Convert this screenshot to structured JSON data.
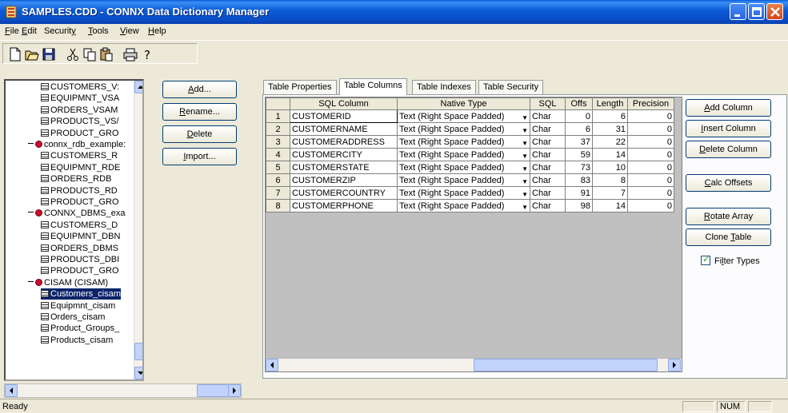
{
  "window": {
    "title": "SAMPLES.CDD - CONNX Data Dictionary Manager"
  },
  "menu": [
    {
      "label_pre": "",
      "label_key": "F",
      "label_post": "ile"
    },
    {
      "label_pre": "",
      "label_key": "E",
      "label_post": "dit"
    },
    {
      "label_pre": "Securit",
      "label_key": "y",
      "label_post": ""
    },
    {
      "label_pre": "",
      "label_key": "T",
      "label_post": "ools"
    },
    {
      "label_pre": "",
      "label_key": "V",
      "label_post": "iew"
    },
    {
      "label_pre": "",
      "label_key": "H",
      "label_post": "elp"
    }
  ],
  "toolbar": {
    "icons": [
      "new-icon",
      "open-icon",
      "save-icon",
      "cut-icon",
      "copy-icon",
      "paste-icon",
      "print-icon",
      "help-icon"
    ]
  },
  "tree": {
    "items": [
      {
        "type": "table",
        "label": "CUSTOMERS_V:",
        "indent": 1
      },
      {
        "type": "table",
        "label": "EQUIPMNT_VSA",
        "indent": 1
      },
      {
        "type": "table",
        "label": "ORDERS_VSAM",
        "indent": 1
      },
      {
        "type": "table",
        "label": "PRODUCTS_VS/",
        "indent": 1
      },
      {
        "type": "table",
        "label": "PRODUCT_GRO",
        "indent": 1
      },
      {
        "type": "db",
        "label": "connx_rdb_example:",
        "indent": 0
      },
      {
        "type": "table",
        "label": "CUSTOMERS_R",
        "indent": 1
      },
      {
        "type": "table",
        "label": "EQUIPMNT_RDE",
        "indent": 1
      },
      {
        "type": "table",
        "label": "ORDERS_RDB",
        "indent": 1
      },
      {
        "type": "table",
        "label": "PRODUCTS_RD",
        "indent": 1
      },
      {
        "type": "table",
        "label": "PRODUCT_GRO",
        "indent": 1
      },
      {
        "type": "db",
        "label": "CONNX_DBMS_exa",
        "indent": 0
      },
      {
        "type": "table",
        "label": "CUSTOMERS_D",
        "indent": 1
      },
      {
        "type": "table",
        "label": "EQUIPMNT_DBN",
        "indent": 1
      },
      {
        "type": "table",
        "label": "ORDERS_DBMS",
        "indent": 1
      },
      {
        "type": "table",
        "label": "PRODUCTS_DBI",
        "indent": 1
      },
      {
        "type": "table",
        "label": "PRODUCT_GRO",
        "indent": 1
      },
      {
        "type": "db",
        "label": "CISAM (CISAM)",
        "indent": 0
      },
      {
        "type": "table",
        "label": "Customers_cisam",
        "indent": 1,
        "selected": true
      },
      {
        "type": "table",
        "label": "Equipmnt_cisam",
        "indent": 1
      },
      {
        "type": "table",
        "label": "Orders_cisam",
        "indent": 1
      },
      {
        "type": "table",
        "label": "Product_Groups_",
        "indent": 1
      },
      {
        "type": "table",
        "label": "Products_cisam",
        "indent": 1
      }
    ]
  },
  "left_buttons": {
    "add": {
      "key": "A",
      "rest": "dd..."
    },
    "rename": {
      "key": "R",
      "rest": "ename..."
    },
    "delete": {
      "key": "D",
      "rest": "elete"
    },
    "import": {
      "key": "I",
      "rest": "mport..."
    }
  },
  "tabs": [
    "Table Properties",
    "Table Columns",
    "Table Indexes",
    "Table Security"
  ],
  "active_tab": 1,
  "grid": {
    "headers": [
      "",
      "SQL Column",
      "Native Type",
      "SQL",
      "Offs",
      "Length",
      "Precision"
    ],
    "rows": [
      {
        "n": "1",
        "col": "CUSTOMERID",
        "type": "Text (Right Space Padded)",
        "sql": "Char",
        "offs": "0",
        "len": "6",
        "prec": "0"
      },
      {
        "n": "2",
        "col": "CUSTOMERNAME",
        "type": "Text (Right Space Padded)",
        "sql": "Char",
        "offs": "6",
        "len": "31",
        "prec": "0"
      },
      {
        "n": "3",
        "col": "CUSTOMERADDRESS",
        "type": "Text (Right Space Padded)",
        "sql": "Char",
        "offs": "37",
        "len": "22",
        "prec": "0"
      },
      {
        "n": "4",
        "col": "CUSTOMERCITY",
        "type": "Text (Right Space Padded)",
        "sql": "Char",
        "offs": "59",
        "len": "14",
        "prec": "0"
      },
      {
        "n": "5",
        "col": "CUSTOMERSTATE",
        "type": "Text (Right Space Padded)",
        "sql": "Char",
        "offs": "73",
        "len": "10",
        "prec": "0"
      },
      {
        "n": "6",
        "col": "CUSTOMERZIP",
        "type": "Text (Right Space Padded)",
        "sql": "Char",
        "offs": "83",
        "len": "8",
        "prec": "0"
      },
      {
        "n": "7",
        "col": "CUSTOMERCOUNTRY",
        "type": "Text (Right Space Padded)",
        "sql": "Char",
        "offs": "91",
        "len": "7",
        "prec": "0"
      },
      {
        "n": "8",
        "col": "CUSTOMERPHONE",
        "type": "Text (Right Space Padded)",
        "sql": "Char",
        "offs": "98",
        "len": "14",
        "prec": "0"
      }
    ]
  },
  "right_buttons": {
    "add_column": {
      "pre": "",
      "key": "A",
      "rest": "dd Column"
    },
    "insert_column": {
      "pre": "",
      "key": "I",
      "rest": "nsert Column"
    },
    "delete_column": {
      "pre": "",
      "key": "D",
      "rest": "elete Column"
    },
    "calc_offsets": {
      "pre": "",
      "key": "C",
      "rest": "alc Offsets"
    },
    "rotate_array": {
      "pre": "",
      "key": "R",
      "rest": "otate Array"
    },
    "clone_table": {
      "pre": "Clone ",
      "key": "T",
      "rest": "able"
    }
  },
  "filter_types": {
    "pre": "Fi",
    "key": "l",
    "rest": "ter Types",
    "checked": true
  },
  "status": {
    "text": "Ready",
    "num": "NUM"
  },
  "colors": {
    "titlebar": "#0a5fd8",
    "selection": "#0a246a",
    "db_icon": "#c8102e"
  }
}
